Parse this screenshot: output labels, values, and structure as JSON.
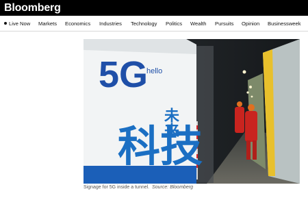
{
  "brand": {
    "logo_text": "Bloomberg"
  },
  "nav": {
    "items": [
      {
        "label": "Live Now",
        "live": true
      },
      {
        "label": "Markets"
      },
      {
        "label": "Economics"
      },
      {
        "label": "Industries"
      },
      {
        "label": "Technology"
      },
      {
        "label": "Politics"
      },
      {
        "label": "Wealth"
      },
      {
        "label": "Pursuits"
      },
      {
        "label": "Opinion"
      },
      {
        "label": "Businessweek"
      }
    ]
  },
  "photo": {
    "signage": {
      "big_label": "5G",
      "hello": "hello",
      "chinese_text": "科技",
      "chinese_side": "未来"
    }
  },
  "caption": {
    "text": "Signage for 5G inside a tunnel.",
    "source": "Source: Bloomberg"
  },
  "colors": {
    "topbar": "#000000",
    "five": "#1f4fa8",
    "g": "#e0262b",
    "calligraphy": "#1b6fc3"
  }
}
